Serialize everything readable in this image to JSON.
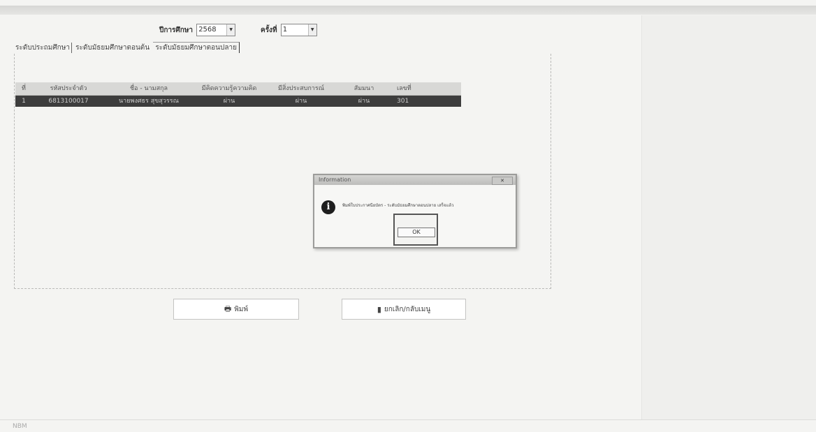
{
  "filters": {
    "year_label": "ปีการศึกษา",
    "year_value": "2568",
    "term_label": "ครั้งที่",
    "term_value": "1"
  },
  "tabs": [
    {
      "label": "ระดับประถมศึกษา"
    },
    {
      "label": "ระดับมัธยมศึกษาตอนต้น"
    },
    {
      "label": "ระดับมัธยมศึกษาตอนปลาย"
    }
  ],
  "table": {
    "headers": [
      "ที่",
      "รหัสประจำตัว",
      "ชื่อ - นามสกุล",
      "มีคิดความรู้ความคิด",
      "มีสิ่งประสบการณ์",
      "สัมมนา",
      "เลขที่"
    ],
    "rows": [
      [
        "1",
        "6813100017",
        "นายพงศธร สุขสุวรรณ",
        "ผ่าน",
        "ผ่าน",
        "ผ่าน",
        "301"
      ]
    ]
  },
  "dialog": {
    "title": "Information",
    "close_label": "✕",
    "message": "พิมพ์ใบประกาศนียบัตร - ระดับมัธยมศึกษาตอนปลาย เสร็จแล้ว",
    "ok_label": "OK"
  },
  "buttons": {
    "print_label": "พิมพ์",
    "cancel_label": "ยกเลิก/กลับเมนู"
  },
  "footer": {
    "text": "NBM"
  }
}
